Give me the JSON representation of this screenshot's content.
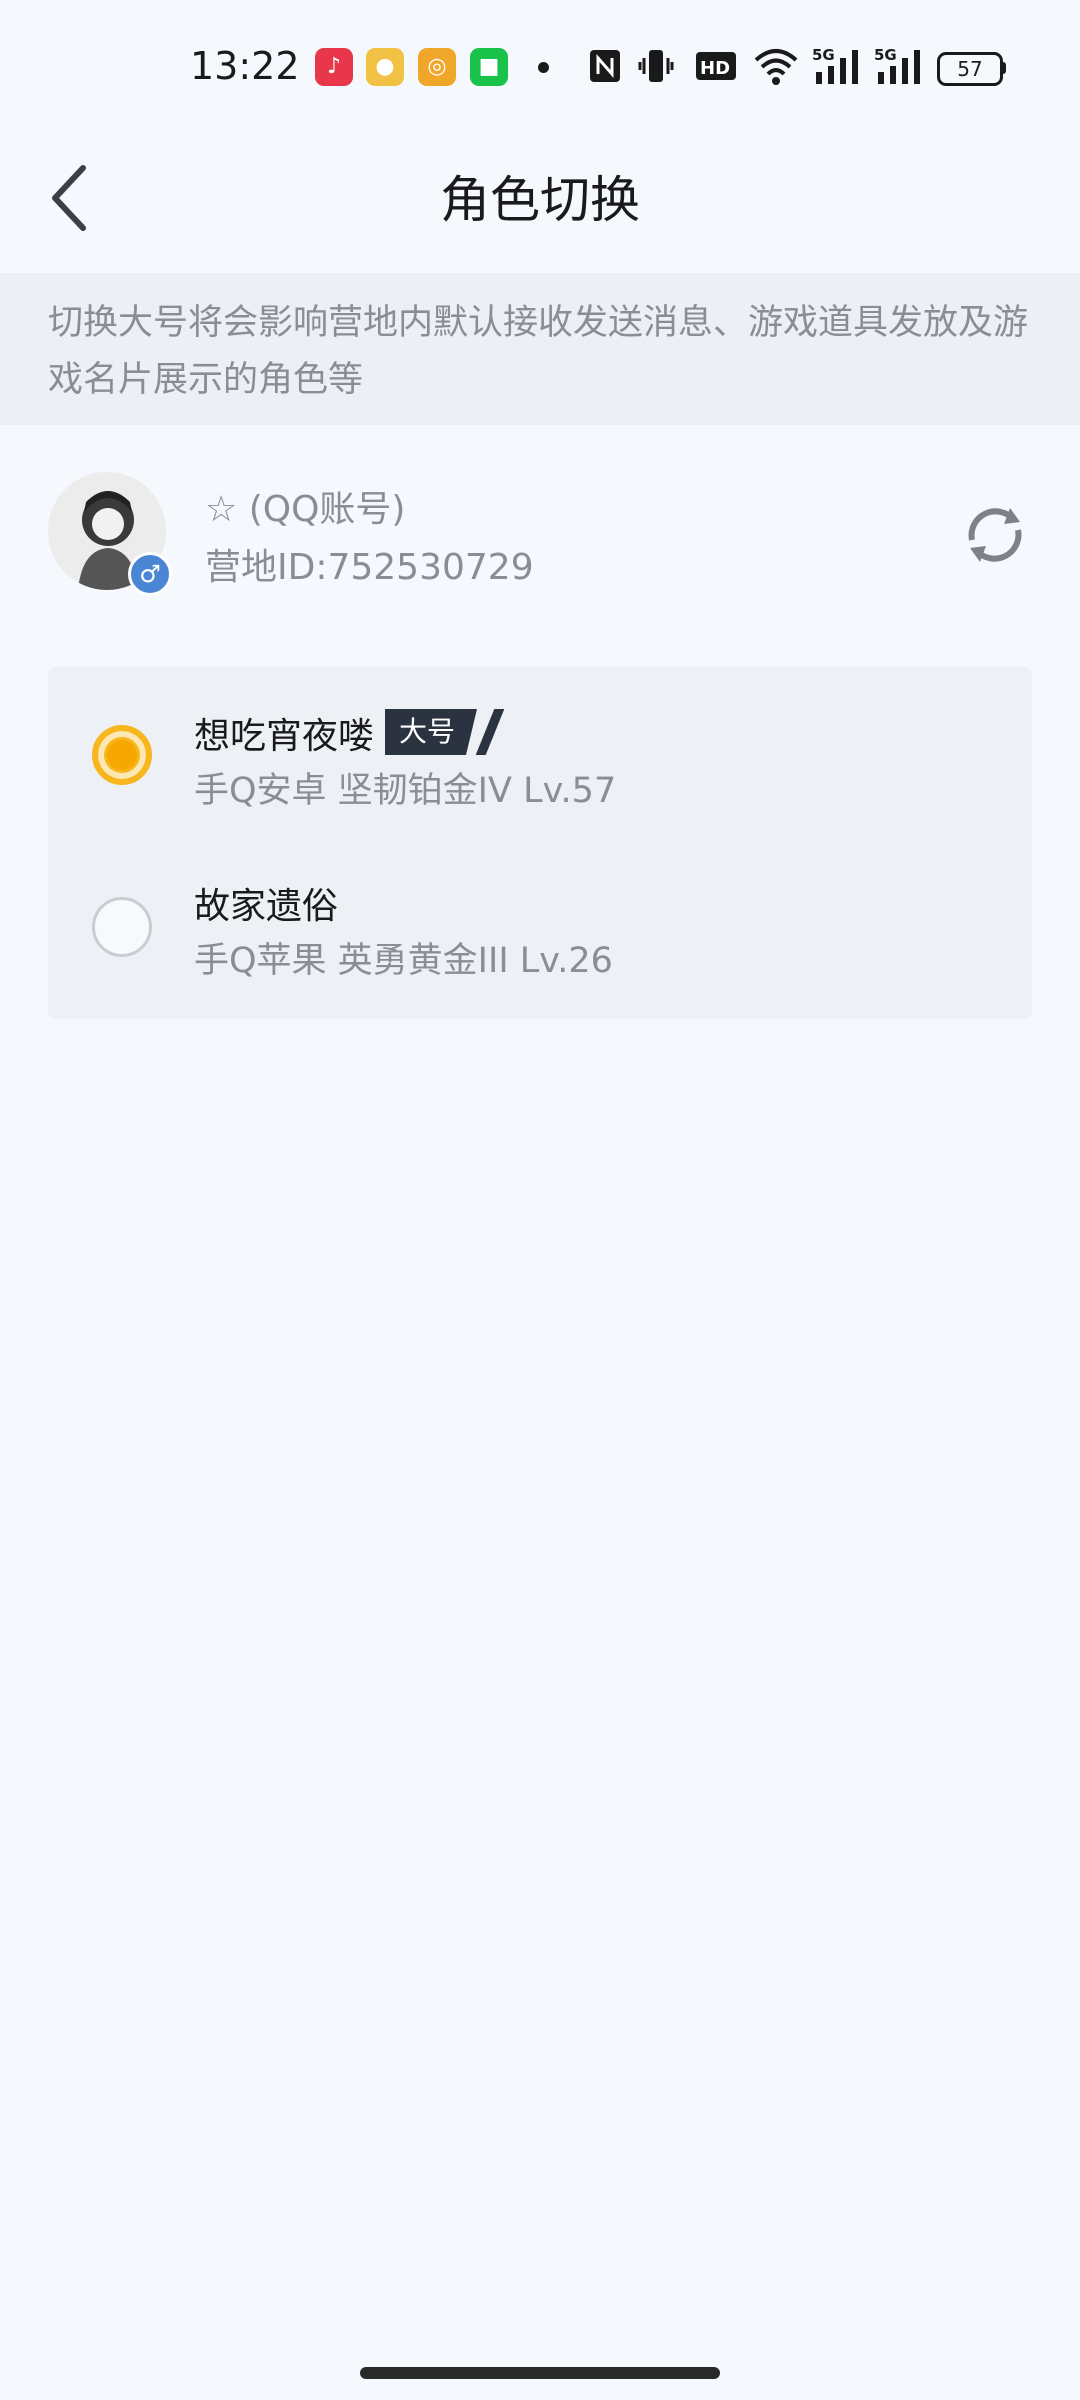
{
  "status_bar": {
    "time": "13:22",
    "battery": "57",
    "icons": [
      "music-app-icon",
      "bear-app-icon",
      "coin-app-icon",
      "green-app-icon",
      "nfc-icon",
      "vibrate-icon",
      "hd-icon",
      "wifi-icon",
      "5g-signal-icon",
      "5g-signal-icon"
    ]
  },
  "header": {
    "title": "角色切换",
    "back_icon": "back-arrow-icon"
  },
  "notice": {
    "text": "切换大号将会影响营地内默认接收发送消息、游戏道具发放及游戏名片展示的角色等"
  },
  "profile": {
    "name": "☆ (QQ账号)",
    "camp_id": "营地ID:752530729",
    "gender": "♂"
  },
  "roles": [
    {
      "name": "想吃宵夜喽",
      "badge": "大号",
      "info": "手Q安卓  坚韧铂金IV  Lv.57",
      "selected": true
    },
    {
      "name": "故家遗俗",
      "badge": "",
      "info": "手Q苹果  英勇黄金III  Lv.26",
      "selected": false
    }
  ],
  "colors": {
    "accent": "#f8b61e",
    "background": "#f5f8fd",
    "notice_bg": "#eceff4"
  }
}
